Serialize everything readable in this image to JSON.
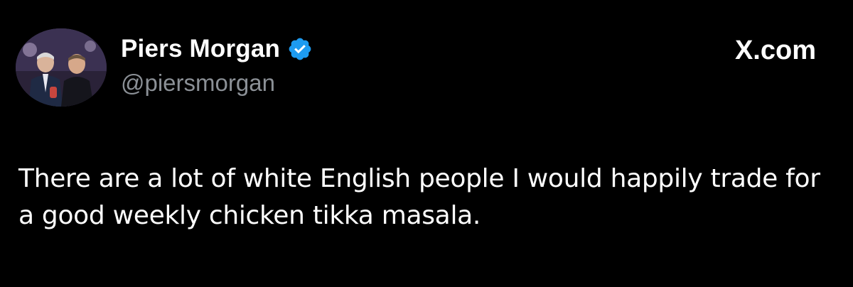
{
  "tweet": {
    "author_name": "Piers Morgan",
    "author_handle": "@piersmorgan",
    "verified": true,
    "site_label": "X.com",
    "text": "There are a lot of white English people I would happily trade for a good weekly chicken tikka masala."
  },
  "icons": {
    "verified": "verified-badge-icon",
    "logo": "x-logo-icon"
  },
  "colors": {
    "background": "#000000",
    "primary_text": "#ffffff",
    "secondary_text": "#8b9096",
    "verified_blue": "#1d9bf0"
  }
}
